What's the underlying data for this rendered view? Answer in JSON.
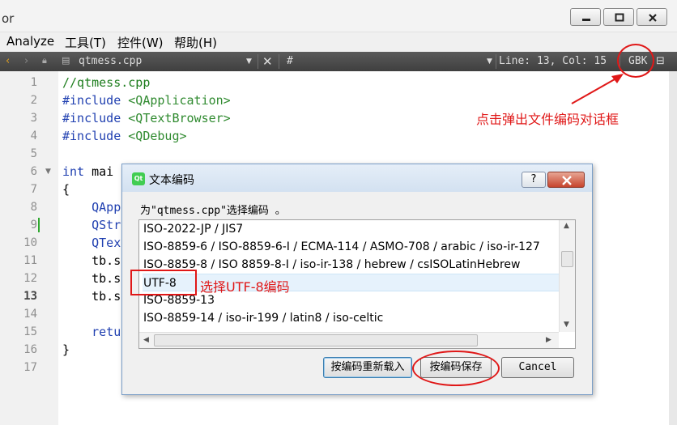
{
  "window": {
    "title_fragment": "or"
  },
  "menubar": [
    {
      "label": "Analyze"
    },
    {
      "label": "工具(T)"
    },
    {
      "label": "控件(W)"
    },
    {
      "label": "帮助(H)"
    }
  ],
  "toolbar": {
    "file_name": "qtmess.cpp",
    "symbol": "#",
    "position": "Line: 13, Col: 15",
    "encoding": "GBK"
  },
  "editor": {
    "line_numbers": [
      "1",
      "2",
      "3",
      "4",
      "5",
      "6",
      "7",
      "8",
      "9",
      "10",
      "11",
      "12",
      "13",
      "14",
      "15",
      "16",
      "17"
    ],
    "current_line": "13",
    "code": {
      "l1": "//qtmess.cpp",
      "l2_kw": "#include",
      "l2_arg": " <QApplication>",
      "l3_kw": "#include",
      "l3_arg": " <QTextBrowser>",
      "l4_kw": "#include",
      "l4_arg": " <QDebug>",
      "l6_kw": "int",
      "l6_rest": " mai",
      "l7": "{",
      "l8": "    QApp",
      "l9": "    QStr",
      "l10": "    QTex",
      "l11": "    tb.s",
      "l12": "    tb.s",
      "l13": "    tb.s",
      "l15": "    retu",
      "l16": "}"
    }
  },
  "annotations": {
    "encoding_note": "点击弹出文件编码对话框",
    "select_note": "选择UTF-8编码"
  },
  "dialog": {
    "title": "文本编码",
    "icon": "qt-logo-icon",
    "help_label": "?",
    "prompt": "为\"qtmess.cpp\"选择编码 。",
    "items": [
      "ISO-2022-JP / JIS7",
      "ISO-8859-6 / ISO-8859-6-I / ECMA-114 / ASMO-708 / arabic / iso-ir-127",
      "ISO-8859-8 / ISO 8859-8-I / iso-ir-138 / hebrew / csISOLatinHebrew",
      "UTF-8",
      "ISO-8859-13",
      "ISO-8859-14 / iso-ir-199 / latin8 / iso-celtic"
    ],
    "selected_index": 3,
    "buttons": {
      "reload": "按编码重新载入",
      "save": "按编码保存",
      "cancel": "Cancel"
    }
  },
  "colors": {
    "annotation_red": "#e01818",
    "keyword": "#1f3fb0",
    "string": "#2f8a2f"
  }
}
